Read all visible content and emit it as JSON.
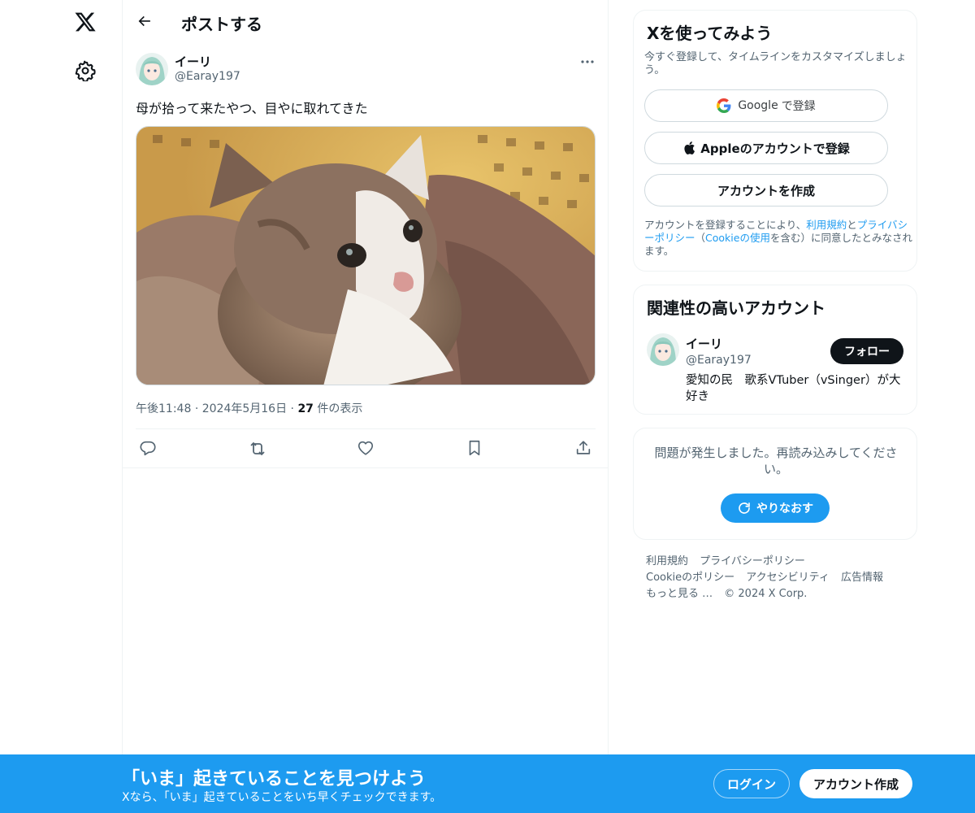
{
  "header": {
    "title": "ポストする"
  },
  "post": {
    "author_name": "イーリ",
    "author_handle": "@Earay197",
    "text": "母が拾って来たやつ、目やに取れてきた",
    "time": "午後11:48",
    "separator": "·",
    "date": "2024年5月16日",
    "views_count": "27",
    "views_label": "件の表示"
  },
  "signup": {
    "title": "Xを使ってみよう",
    "subtitle": "今すぐ登録して、タイムラインをカスタマイズしましょう。",
    "google_brand": "Google",
    "google_label": "で登録",
    "apple_label": "Appleのアカウントで登録",
    "create_label": "アカウントを作成",
    "legal_pre": "アカウントを登録することにより、",
    "legal_terms": "利用規約",
    "legal_and": "と",
    "legal_privacy": "プライバシーポリシー",
    "legal_open": "（",
    "legal_cookie": "Cookieの使用",
    "legal_post": "を含む）に同意したとみなされます。"
  },
  "related": {
    "title": "関連性の高いアカウント",
    "name": "イーリ",
    "handle": "@Earay197",
    "bio": "愛知の民　歌系VTuber（vSinger）が大好き",
    "follow_label": "フォロー"
  },
  "error_card": {
    "message": "問題が発生しました。再読み込みしてください。",
    "retry_label": "やりなおす"
  },
  "footer": {
    "links": [
      "利用規約",
      "プライバシーポリシー",
      "Cookieのポリシー",
      "アクセシビリティ",
      "広告情報",
      "もっと見る …"
    ],
    "copyright": "© 2024 X Corp."
  },
  "bottom_bar": {
    "title": "「いま」起きていることを見つけよう",
    "subtitle": "Xなら、「いま」起きていることをいち早くチェックできます。",
    "login_label": "ログイン",
    "create_label": "アカウント作成"
  },
  "colors": {
    "accent": "#1d9bf0",
    "text": "#0f1419",
    "muted": "#536471",
    "border": "#eff3f4"
  },
  "icons": [
    "x-logo-icon",
    "gear-icon",
    "back-arrow-icon",
    "more-icon",
    "reply-icon",
    "repost-icon",
    "like-icon",
    "bookmark-icon",
    "share-icon",
    "google-icon",
    "apple-icon",
    "refresh-icon"
  ]
}
